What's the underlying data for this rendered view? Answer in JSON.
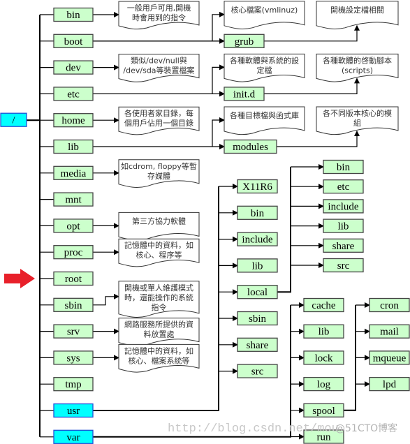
{
  "colors": {
    "node_fill": "#ccffcc",
    "node_stroke": "#444444",
    "highlight_fill": "#00ffff",
    "highlight_stroke": "#1f4fd6",
    "pointer_arrow": "#e8202a",
    "line": "#000000"
  },
  "root": {
    "label": "/"
  },
  "top_level": [
    {
      "id": "bin",
      "label": "bin",
      "doc": "一般用戶可用,開機\n時會用到的指令"
    },
    {
      "id": "boot",
      "label": "boot"
    },
    {
      "id": "dev",
      "label": "dev",
      "doc": "類似/dev/null與\n/dev/sda等裝置檔案"
    },
    {
      "id": "etc",
      "label": "etc"
    },
    {
      "id": "home",
      "label": "home",
      "doc": "各使用者家目錄，每\n個用戶佔用一個目錄"
    },
    {
      "id": "lib",
      "label": "lib"
    },
    {
      "id": "media",
      "label": "media",
      "doc": "如cdrom, floppy等暫\n存媒體"
    },
    {
      "id": "mnt",
      "label": "mnt"
    },
    {
      "id": "opt",
      "label": "opt",
      "doc": "第三方協力軟體"
    },
    {
      "id": "proc",
      "label": "proc",
      "doc": "記憶體中的資料，如\n核心、程序等"
    },
    {
      "id": "root",
      "label": "root",
      "pointed": true
    },
    {
      "id": "sbin",
      "label": "sbin",
      "doc": "開機或單人維護模式\n時，還能操作的系統\n指令"
    },
    {
      "id": "srv",
      "label": "srv",
      "doc": "網路服務所提供的資\n料放置處"
    },
    {
      "id": "sys",
      "label": "sys",
      "doc": "記憶體中的資料，如\n核心、檔案系統等"
    },
    {
      "id": "tmp",
      "label": "tmp"
    },
    {
      "id": "usr",
      "label": "usr",
      "highlight": true
    },
    {
      "id": "var",
      "label": "var",
      "highlight": true
    }
  ],
  "sub_branches": [
    {
      "parent": "boot",
      "child": "grub",
      "doc_left": "核心檔案(vmlinuz)",
      "doc_right": "開機設定檔相關"
    },
    {
      "parent": "etc",
      "child": "init.d",
      "doc_left": "各種軟體與系統的設\n定檔",
      "doc_right": "各種軟體的啓動腳本\n(scripts)"
    },
    {
      "parent": "lib",
      "child": "modules",
      "doc_left": "各種目標檔與函式庫",
      "doc_right": "各不同版本核心的模\n組"
    }
  ],
  "usr_children": [
    "X11R6",
    "bin",
    "include",
    "lib",
    "local",
    "sbin",
    "share",
    "src"
  ],
  "local_children": [
    "bin",
    "etc",
    "include",
    "lib",
    "share",
    "src"
  ],
  "var_children": [
    "cache",
    "lib",
    "lock",
    "log",
    "spool",
    "run"
  ],
  "spool_children": [
    "cron",
    "mail",
    "mqueue",
    "lpd"
  ],
  "watermark": {
    "url": "http://blog.csdn.net/mou",
    "brand": "@51CTO博客"
  }
}
